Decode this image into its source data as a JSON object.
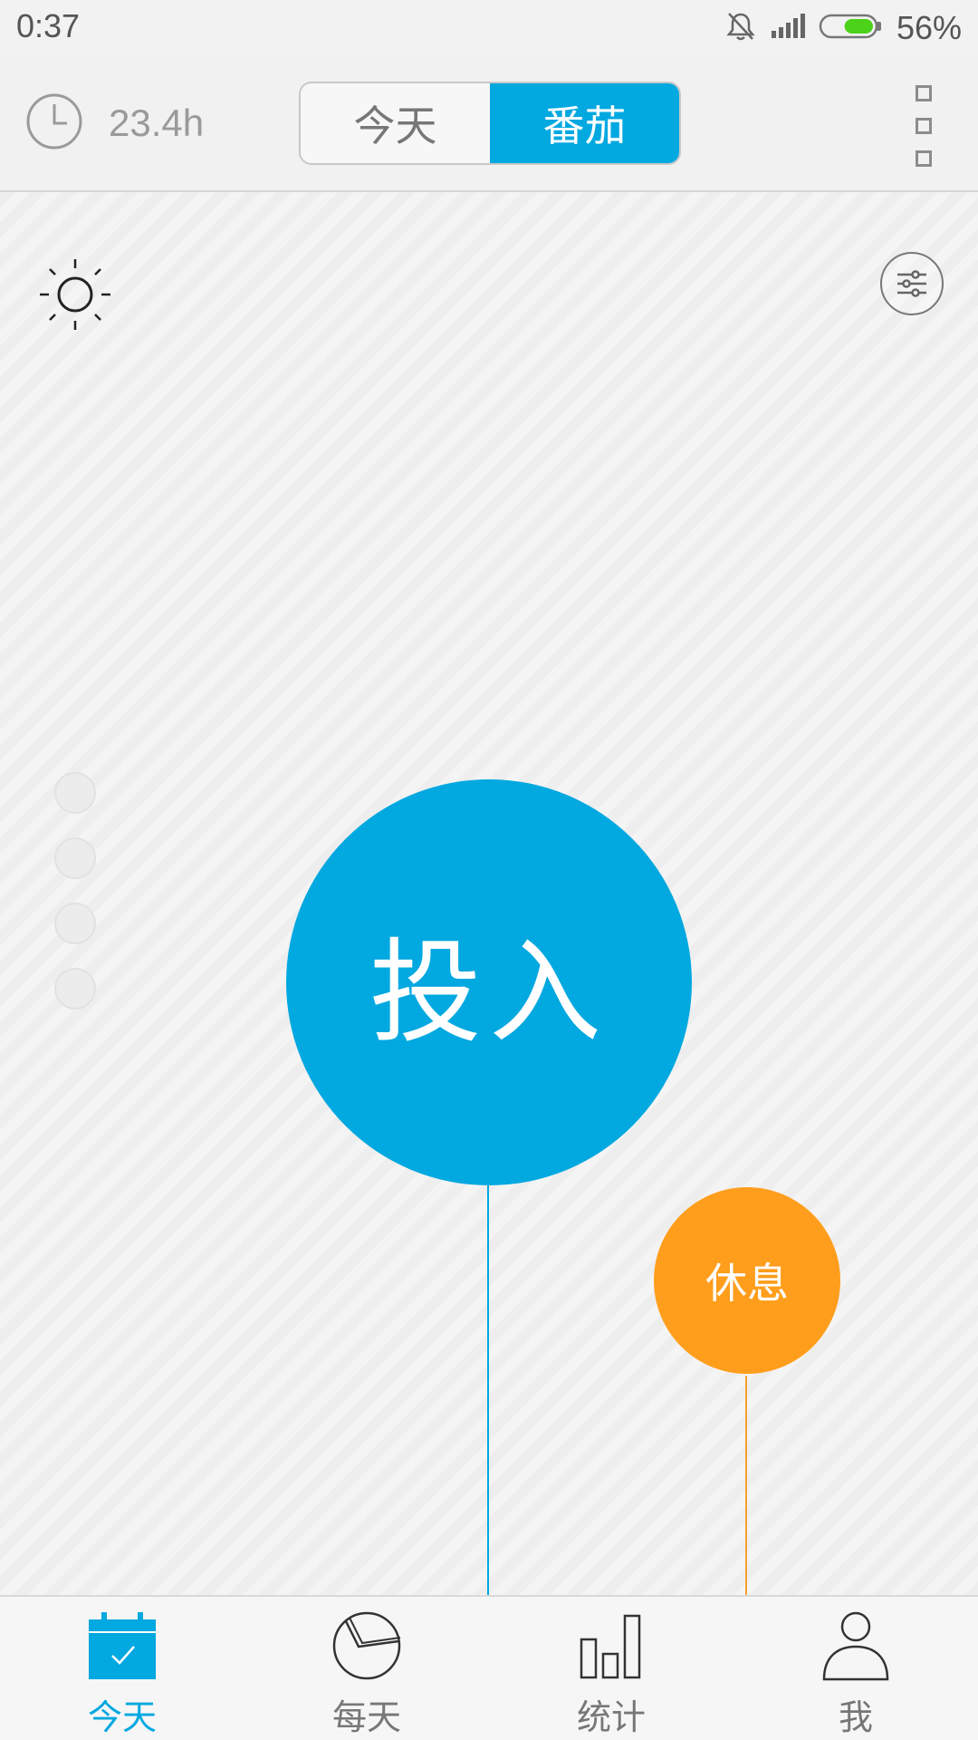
{
  "status_bar": {
    "time": "0:37",
    "battery_percent_text": "56%",
    "battery_level": 0.56,
    "icons": [
      "mute-icon",
      "signal-icon",
      "battery-icon"
    ]
  },
  "header": {
    "total_hours": "23.4h",
    "segments": [
      {
        "label": "今天",
        "selected": false
      },
      {
        "label": "番茄",
        "selected": true
      }
    ],
    "menu_icon": "grid-menu-icon"
  },
  "main": {
    "theme_icon": "sun-icon",
    "filter_icon": "sliders-icon",
    "progress_dots": 4,
    "focus_button_label": "投入",
    "rest_button_label": "休息"
  },
  "tabbar": {
    "items": [
      {
        "label": "今天",
        "icon": "calendar-check-icon",
        "active": true
      },
      {
        "label": "每天",
        "icon": "pie-chart-icon",
        "active": false
      },
      {
        "label": "统计",
        "icon": "bar-chart-icon",
        "active": false
      },
      {
        "label": "我",
        "icon": "user-icon",
        "active": false
      }
    ]
  },
  "colors": {
    "accent_blue": "#02a8e0",
    "rest_orange": "#ff9e1c",
    "battery_green": "#4cd21a"
  }
}
